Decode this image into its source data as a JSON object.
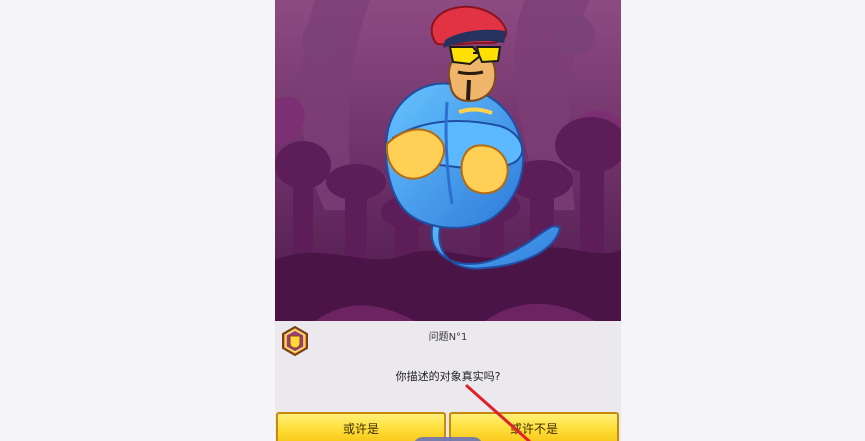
{
  "game": {
    "question_number": "问题N°1",
    "question": "你描述的对象真实吗?",
    "answers": {
      "left": "或许是",
      "right": "或许不是"
    }
  },
  "icons": {
    "badge": "awards-badge-icon",
    "arrow": "red-arrow-annotation"
  },
  "colors": {
    "background": "#f5f5f8",
    "scene_purple": "#6b2a63",
    "genie_blue": "#4aa6f0",
    "button_yellow": "#ffe03d",
    "button_border": "#c88a0a",
    "annotation_red": "#e0202a"
  }
}
